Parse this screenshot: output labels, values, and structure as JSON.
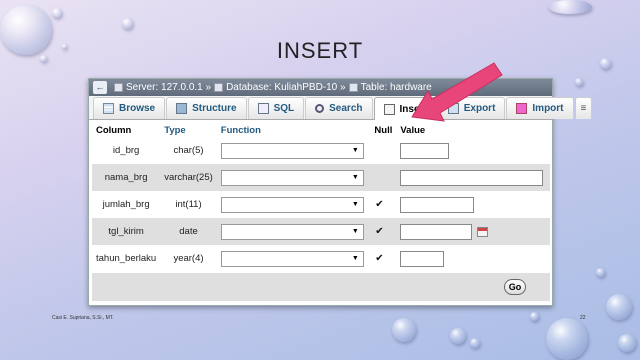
{
  "slide": {
    "title": "INSERT",
    "author": "Casi E. Supriana, S.Si., MT.",
    "page_number": "22"
  },
  "breadcrumb": {
    "back_icon": "arrow-left",
    "server": "Server: 127.0.0.1 »",
    "database": "Database: KuliahPBD-10 »",
    "table": "Table: hardware"
  },
  "tabs": [
    {
      "label": "Browse",
      "icon": "browse-icon",
      "active": false
    },
    {
      "label": "Structure",
      "icon": "structure-icon",
      "active": false
    },
    {
      "label": "SQL",
      "icon": "sql-icon",
      "active": false
    },
    {
      "label": "Search",
      "icon": "search-icon",
      "active": false
    },
    {
      "label": "Insert",
      "icon": "insert-icon",
      "active": true
    },
    {
      "label": "Export",
      "icon": "export-icon",
      "active": false
    },
    {
      "label": "Import",
      "icon": "import-icon",
      "active": false
    },
    {
      "label": "≡",
      "icon": "more-icon",
      "active": false
    }
  ],
  "table_headers": {
    "column": "Column",
    "type": "Type",
    "function": "Function",
    "null": "Null",
    "value": "Value"
  },
  "rows": [
    {
      "column": "id_brg",
      "type": "char(5)",
      "function": "",
      "null_checked": false,
      "value": ""
    },
    {
      "column": "nama_brg",
      "type": "varchar(25)",
      "function": "",
      "null_checked": false,
      "value": ""
    },
    {
      "column": "jumlah_brg",
      "type": "int(11)",
      "function": "",
      "null_checked": true,
      "value": ""
    },
    {
      "column": "tgl_kirim",
      "type": "date",
      "function": "",
      "null_checked": true,
      "value": ""
    },
    {
      "column": "tahun_berlaku",
      "type": "year(4)",
      "function": "",
      "null_checked": true,
      "value": ""
    }
  ],
  "go_button": "Go",
  "colors": {
    "arrow": "#e8457a",
    "tab_text": "#235a81",
    "breadcrumb_bg": "#6b7788"
  }
}
